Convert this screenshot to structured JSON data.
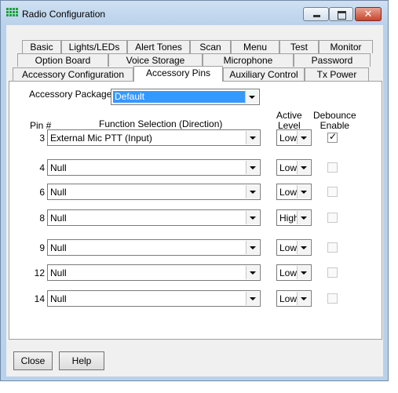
{
  "window": {
    "title": "Radio Configuration"
  },
  "tabs": {
    "row1": [
      "Basic",
      "Lights/LEDs",
      "Alert Tones",
      "Scan",
      "Menu",
      "Test",
      "Monitor"
    ],
    "row2": [
      "Option Board",
      "Voice Storage",
      "Microphone",
      "Password"
    ],
    "row3": [
      "Accessory Configuration",
      "Accessory Pins",
      "Auxiliary Control",
      "Tx Power"
    ],
    "active": "Accessory Pins"
  },
  "accessory": {
    "package_label": "Accessory Package:",
    "package_value": "Default"
  },
  "headers": {
    "pin": "Pin #",
    "function": "Function Selection (Direction)",
    "active_level": "Active\nLevel",
    "debounce": "Debounce\nEnable"
  },
  "pins": [
    {
      "pin": "3",
      "function": "External Mic PTT (Input)",
      "level": "Low",
      "debounce": true,
      "debounce_enabled": true
    },
    {
      "pin": "4",
      "function": "Null",
      "level": "Low",
      "debounce": false,
      "debounce_enabled": false
    },
    {
      "pin": "6",
      "function": "Null",
      "level": "Low",
      "debounce": false,
      "debounce_enabled": false
    },
    {
      "pin": "8",
      "function": "Null",
      "level": "High",
      "debounce": false,
      "debounce_enabled": false
    },
    {
      "pin": "9",
      "function": "Null",
      "level": "Low",
      "debounce": false,
      "debounce_enabled": false
    },
    {
      "pin": "12",
      "function": "Null",
      "level": "Low",
      "debounce": false,
      "debounce_enabled": false
    },
    {
      "pin": "14",
      "function": "Null",
      "level": "Low",
      "debounce": false,
      "debounce_enabled": false
    }
  ],
  "buttons": {
    "close": "Close",
    "help": "Help"
  },
  "colors": {
    "titlebar": "#b9d1ea",
    "selection": "#3399ff",
    "close_button": "#c8442c"
  }
}
